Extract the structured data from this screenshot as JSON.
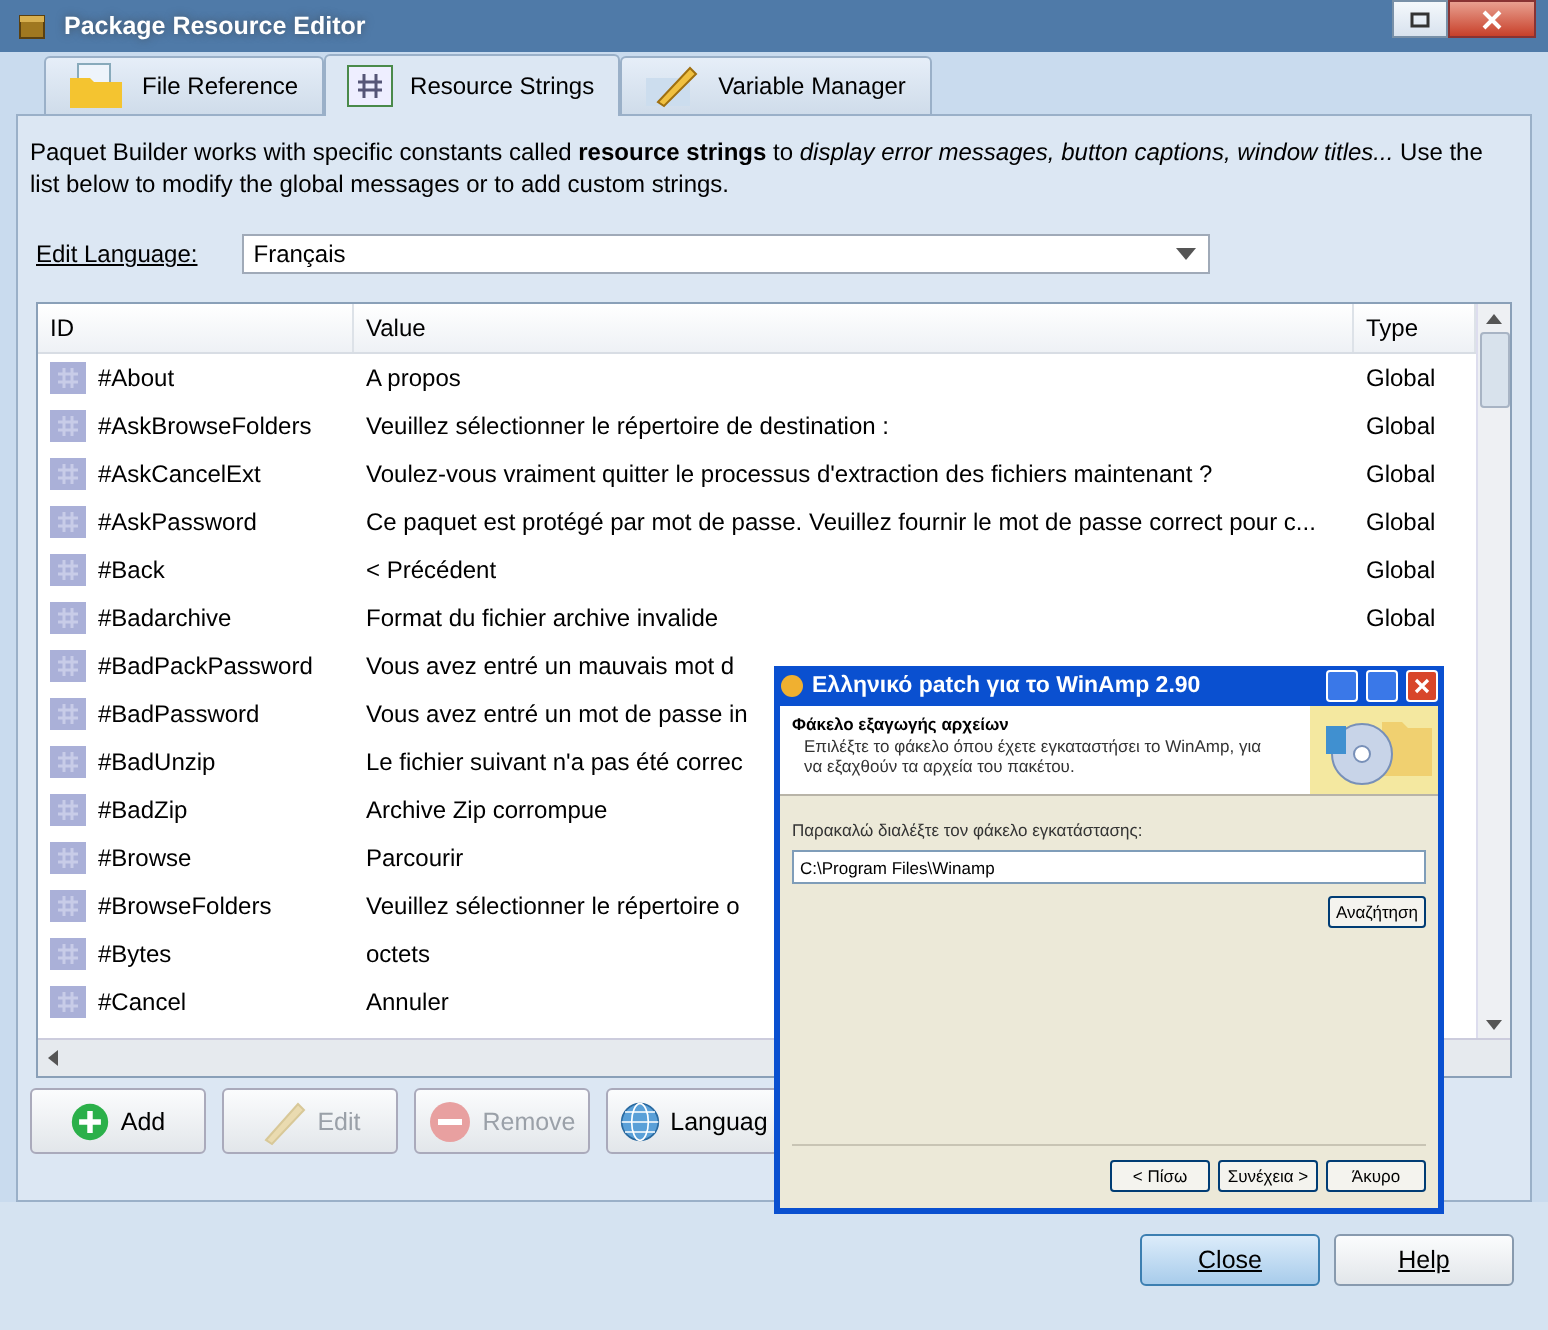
{
  "window": {
    "title": "Package Resource Editor"
  },
  "tabs": [
    {
      "label": "File Reference",
      "selected": false,
      "kind": "folder"
    },
    {
      "label": "Resource Strings",
      "selected": true,
      "kind": "hash"
    },
    {
      "label": "Variable Manager",
      "selected": false,
      "kind": "pencil"
    }
  ],
  "description": "Paquet Builder works with specific constants called **resource strings** to *display error messages, button captions, window titles...* Use the list below to modify the global messages or to add custom strings.",
  "edit_language": {
    "label": "Edit Language:",
    "value": "Français"
  },
  "table": {
    "columns": [
      "ID",
      "Value",
      "Type"
    ],
    "rows": [
      {
        "id": "#About",
        "value": "A propos",
        "type": "Global"
      },
      {
        "id": "#AskBrowseFolders",
        "value": "Veuillez sélectionner le répertoire de destination :",
        "type": "Global"
      },
      {
        "id": "#AskCancelExt",
        "value": "Voulez-vous vraiment quitter le processus d'extraction des fichiers maintenant ?",
        "type": "Global"
      },
      {
        "id": "#AskPassword",
        "value": "Ce paquet est protégé par mot de passe. Veuillez fournir le mot de passe correct pour c...",
        "type": "Global"
      },
      {
        "id": "#Back",
        "value": "< Précédent",
        "type": "Global"
      },
      {
        "id": "#Badarchive",
        "value": "Format du fichier archive invalide",
        "type": "Global"
      },
      {
        "id": "#BadPackPassword",
        "value": "Vous avez entré un mauvais mot d"
      },
      {
        "id": "#BadPassword",
        "value": "Vous avez entré un mot de passe in"
      },
      {
        "id": "#BadUnzip",
        "value": "Le fichier suivant n'a pas été correc"
      },
      {
        "id": "#BadZip",
        "value": "Archive Zip corrompue"
      },
      {
        "id": "#Browse",
        "value": "Parcourir"
      },
      {
        "id": "#BrowseFolders",
        "value": "Veuillez sélectionner le répertoire o"
      },
      {
        "id": "#Bytes",
        "value": "octets"
      },
      {
        "id": "#Cancel",
        "value": "Annuler"
      }
    ]
  },
  "buttons": [
    {
      "label": "Add",
      "disabled": false,
      "kind": "add"
    },
    {
      "label": "Edit",
      "disabled": true,
      "kind": "edit"
    },
    {
      "label": "Remove",
      "disabled": true,
      "kind": "remove"
    },
    {
      "label": "Languag",
      "disabled": false,
      "kind": "language"
    }
  ],
  "dialog_buttons": [
    {
      "label": "Close",
      "default": true
    },
    {
      "label": "Help",
      "default": false
    }
  ],
  "overlay_window": {
    "title": "Ελληνικό patch για το WinAmp 2.90",
    "heading": "Φάκελο εξαγωγής αρχείων",
    "subheading": "Επιλέξτε το φάκελο όπου έχετε εγκαταστήσει το WinAmp, για να εξαχθούν τα αρχεία του πακέτου.",
    "prompt": "Παρακαλώ διαλέξτε τον φάκελο εγκατάστασης:",
    "path": "C:\\Program Files\\Winamp",
    "browse": "Αναζήτηση",
    "buttons": [
      "< Πίσω",
      "Συνέχεια >",
      "Άκυρο"
    ]
  }
}
